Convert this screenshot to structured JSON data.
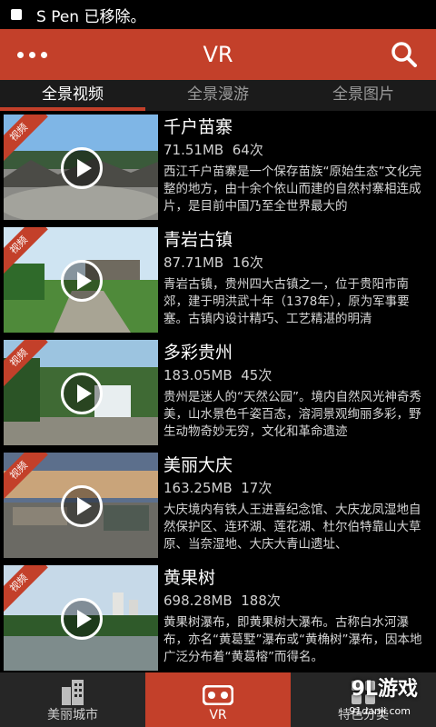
{
  "status": {
    "text": "S Pen 已移除。"
  },
  "app_bar": {
    "title": "VR",
    "menu_icon": "more-dots-icon",
    "search_icon": "search-icon"
  },
  "tabs": [
    {
      "label": "全景视频",
      "active": true
    },
    {
      "label": "全景漫游",
      "active": false
    },
    {
      "label": "全景图片",
      "active": false
    }
  ],
  "items": [
    {
      "badge": "视频",
      "name": "千户苗寨",
      "size": "71.51MB",
      "count": "64次",
      "desc": "西江千户苗寨是一个保存苗族“原始生态”文化完整的地方，由十余个依山而建的自然村寨相连成片，是目前中国乃至全世界最大的"
    },
    {
      "badge": "视频",
      "name": "青岩古镇",
      "size": "87.71MB",
      "count": "16次",
      "desc": "青岩古镇，贵州四大古镇之一，位于贵阳市南郊，建于明洪武十年（1378年），原为军事要塞。古镇内设计精巧、工艺精湛的明清"
    },
    {
      "badge": "视频",
      "name": "多彩贵州",
      "size": "183.05MB",
      "count": "45次",
      "desc": "贵州是迷人的“天然公园”。境内自然风光神奇秀美，山水景色千姿百态，溶洞景观绚丽多彩，野生动物奇妙无穷，文化和革命遗迹"
    },
    {
      "badge": "视频",
      "name": "美丽大庆",
      "size": "163.25MB",
      "count": "17次",
      "desc": "大庆境内有铁人王进喜纪念馆、大庆龙凤湿地自然保护区、连环湖、莲花湖、杜尔伯特靠山大草原、当奈湿地、大庆大青山遗址、"
    },
    {
      "badge": "视频",
      "name": "黄果树",
      "size": "698.28MB",
      "count": "188次",
      "desc": "黄果树瀑布，即黄果树大瀑布。古称白水河瀑布，亦名“黄葛墅”瀑布或“黄桷树”瀑布，因本地广泛分布着“黄葛榕”而得名。"
    }
  ],
  "bottom_nav": [
    {
      "label": "美丽城市",
      "icon": "building-icon",
      "active": false
    },
    {
      "label": "VR",
      "icon": "vr-goggles-icon",
      "active": true
    },
    {
      "label": "特色分类",
      "icon": "grid-icon",
      "active": false
    }
  ],
  "watermark": {
    "logo": "9L游戏",
    "site": "91danji.com"
  },
  "colors": {
    "accent": "#c3402a"
  }
}
